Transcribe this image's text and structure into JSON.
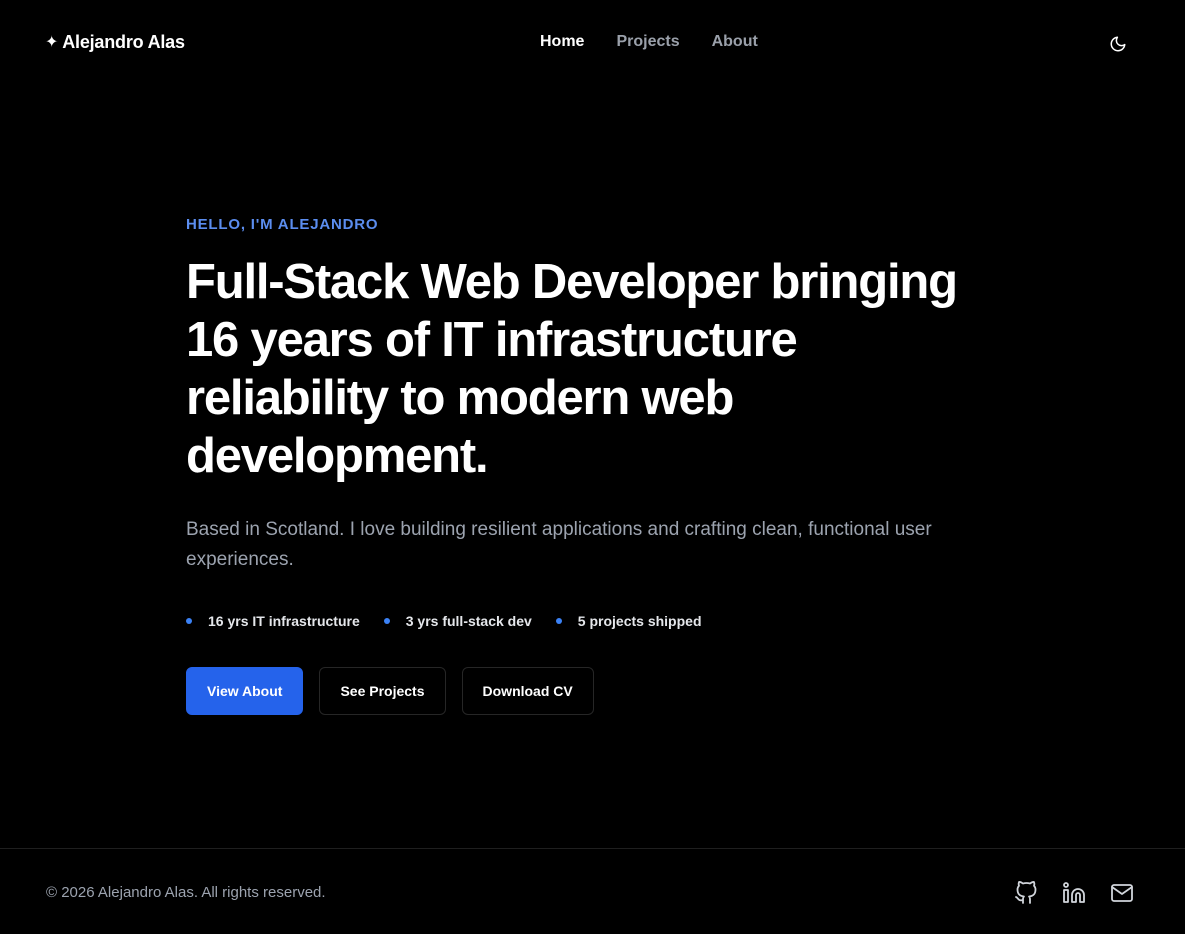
{
  "header": {
    "brand_star": "✦",
    "brand_name": "Alejandro Alas",
    "nav": [
      {
        "label": "Home",
        "active": true
      },
      {
        "label": "Projects",
        "active": false
      },
      {
        "label": "About",
        "active": false
      }
    ],
    "theme_icon": "moon-icon"
  },
  "hero": {
    "eyebrow": "HELLO, I'M ALEJANDRO",
    "headline": "Full-Stack Web Developer bringing 16 years of IT infrastructure reliability to modern web development.",
    "subtitle": "Based in Scotland. I love building resilient applications and crafting clean, functional user experiences.",
    "stats": [
      "16 yrs IT infrastructure",
      "3 yrs full-stack dev",
      "5 projects shipped"
    ],
    "buttons": {
      "view_about": "View About",
      "see_projects": "See Projects",
      "download_cv": "Download CV"
    }
  },
  "footer": {
    "copyright": "© 2026 Alejandro Alas. All rights reserved.",
    "socials": [
      "github-icon",
      "linkedin-icon",
      "mail-icon"
    ]
  },
  "colors": {
    "background": "#000000",
    "accent": "#2563eb",
    "eyebrow": "#5b8def",
    "muted_text": "#9ca3af"
  }
}
